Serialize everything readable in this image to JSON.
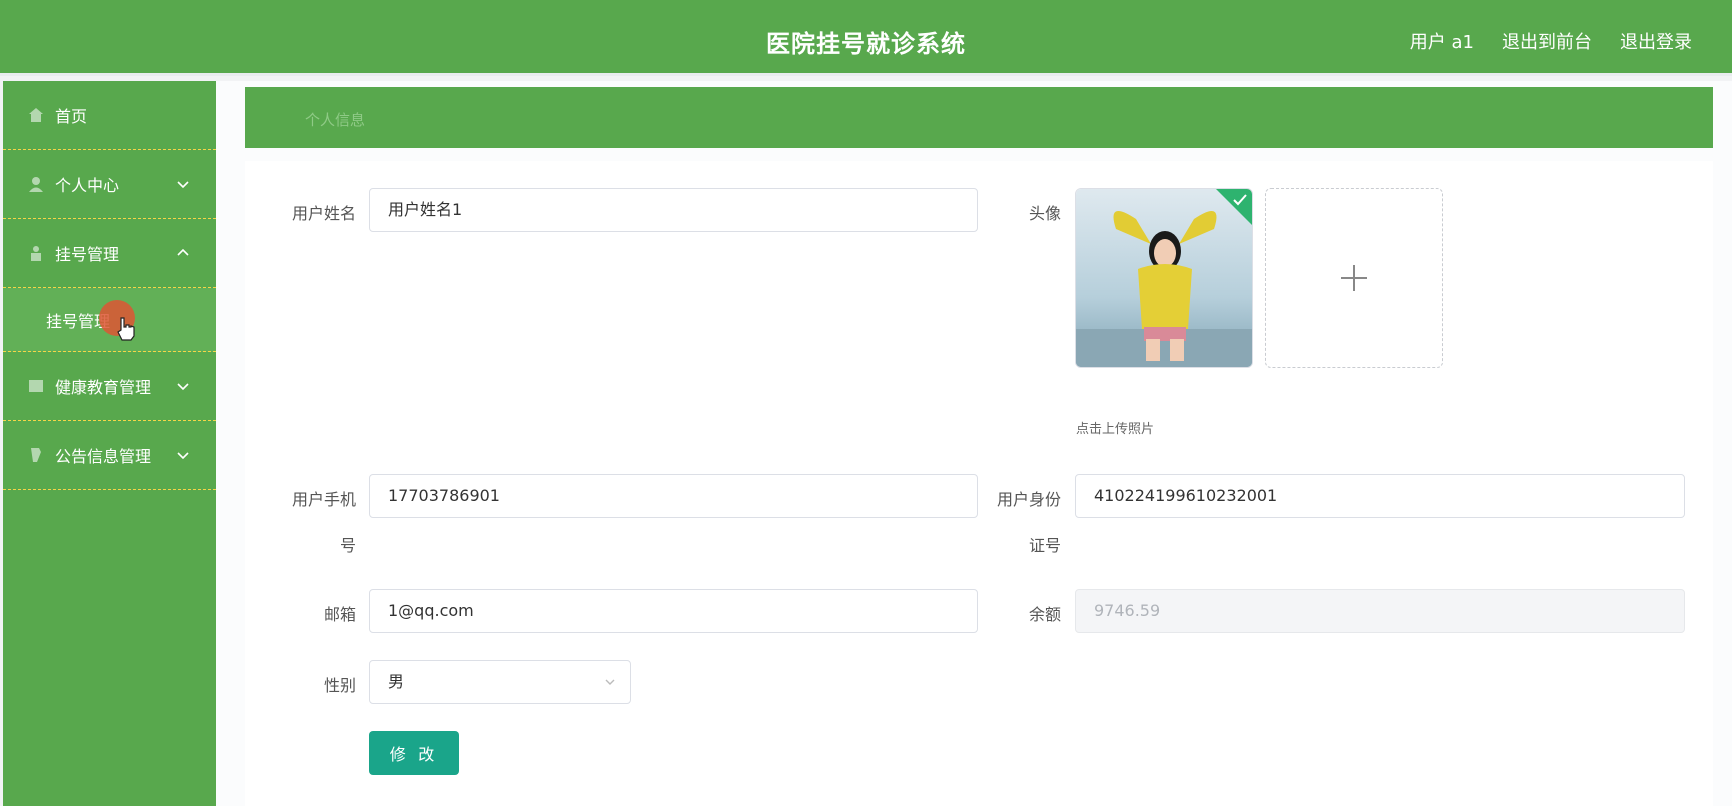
{
  "header": {
    "title": "医院挂号就诊系统",
    "user": "用户 a1",
    "to_front": "退出到前台",
    "logout": "退出登录"
  },
  "sidebar": {
    "items": [
      {
        "label": "首页",
        "icon": "home-icon"
      },
      {
        "label": "个人中心",
        "icon": "user-icon"
      },
      {
        "label": "挂号管理",
        "icon": "register-icon"
      },
      {
        "label": "健康教育管理",
        "icon": "education-icon"
      },
      {
        "label": "公告信息管理",
        "icon": "notice-icon"
      }
    ],
    "sub_item": "挂号管理"
  },
  "breadcrumb": "个人信息",
  "form": {
    "name_label": "用户姓名",
    "name_value": "用户姓名1",
    "avatar_label": "头像",
    "upload_tip": "点击上传照片",
    "phone_label_1": "用户手机",
    "phone_label_2": "号",
    "phone_value": "17703786901",
    "id_label_1": "用户身份",
    "id_label_2": "证号",
    "id_value": "410224199610232001",
    "email_label": "邮箱",
    "email_value": "1@qq.com",
    "balance_label": "余额",
    "balance_value": "9746.59",
    "gender_label": "性别",
    "gender_value": "男",
    "submit": "修 改"
  },
  "colors": {
    "primary_green": "#58a84d",
    "button_teal": "#1aa58a"
  }
}
